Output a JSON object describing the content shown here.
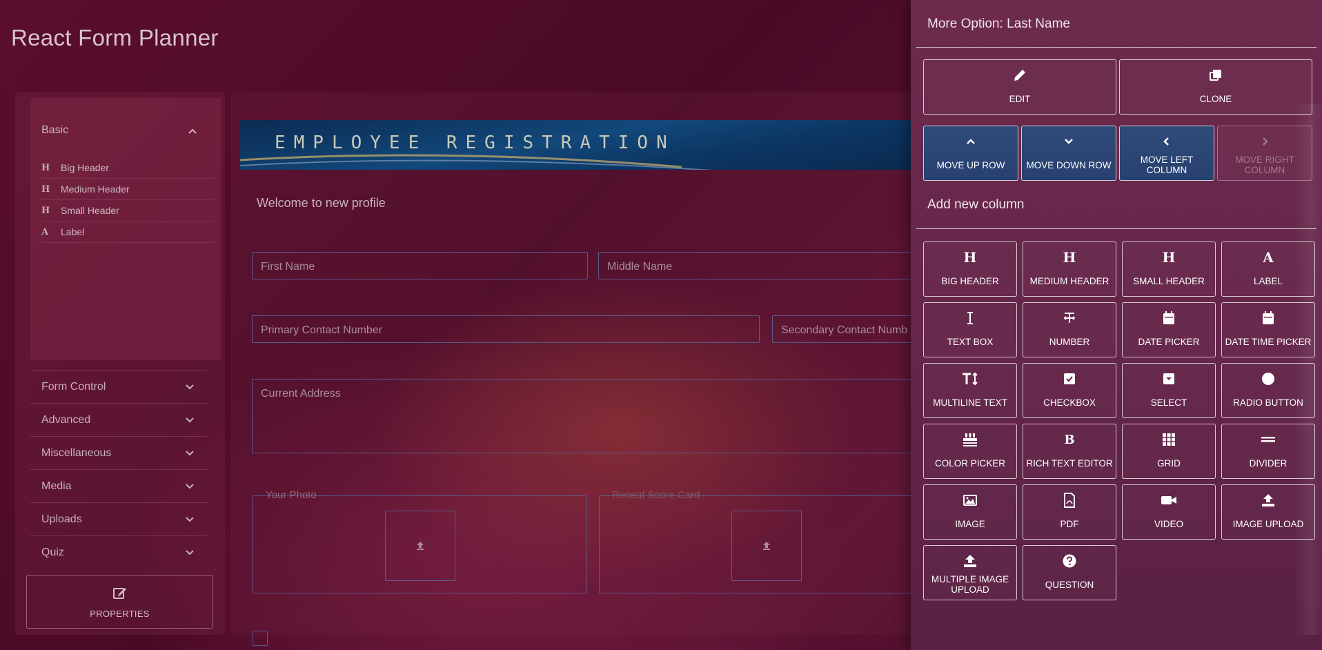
{
  "app": {
    "title": "React Form Planner"
  },
  "sidebar": {
    "basic": {
      "label": "Basic",
      "items": [
        {
          "glyph": "H",
          "label": "Big Header"
        },
        {
          "glyph": "H",
          "label": "Medium Header"
        },
        {
          "glyph": "H",
          "label": "Small Header"
        },
        {
          "glyph": "A",
          "label": "Label"
        }
      ]
    },
    "sections": [
      "Form Control",
      "Advanced",
      "Miscellaneous",
      "Media",
      "Uploads",
      "Quiz"
    ],
    "properties_label": "PROPERTIES"
  },
  "form": {
    "banner_text": "EMPLOYEE REGISTRATION",
    "welcome": "Welcome to new profile",
    "fields": {
      "first_name": "First Name",
      "middle_name": "Middle Name",
      "primary_contact": "Primary Contact Number",
      "secondary_contact": "Secondary Contact Numb",
      "current_address": "Current Address"
    },
    "uploads": {
      "photo": "Your Photo",
      "score_card": "Recent Score Card"
    }
  },
  "drawer": {
    "title": "More Option: Last Name",
    "actions": {
      "edit": "EDIT",
      "clone": "CLONE"
    },
    "move": {
      "up": "MOVE UP ROW",
      "down": "MOVE DOWN ROW",
      "left": "MOVE LEFT COLUMN",
      "right": "MOVE RIGHT COLUMN"
    },
    "add_column_title": "Add new column",
    "tiles": [
      {
        "label": "BIG HEADER"
      },
      {
        "label": "MEDIUM HEADER"
      },
      {
        "label": "SMALL HEADER"
      },
      {
        "label": "LABEL"
      },
      {
        "label": "TEXT BOX"
      },
      {
        "label": "NUMBER"
      },
      {
        "label": "DATE PICKER"
      },
      {
        "label": "DATE TIME PICKER"
      },
      {
        "label": "MULTILINE TEXT"
      },
      {
        "label": "CHECKBOX"
      },
      {
        "label": "SELECT"
      },
      {
        "label": "RADIO BUTTON"
      },
      {
        "label": "COLOR PICKER"
      },
      {
        "label": "RICH TEXT EDITOR"
      },
      {
        "label": "GRID"
      },
      {
        "label": "DIVIDER"
      },
      {
        "label": "IMAGE"
      },
      {
        "label": "PDF"
      },
      {
        "label": "VIDEO"
      },
      {
        "label": "IMAGE UPLOAD"
      },
      {
        "label": "MULTIPLE IMAGE UPLOAD"
      },
      {
        "label": "QUESTION"
      }
    ]
  }
}
